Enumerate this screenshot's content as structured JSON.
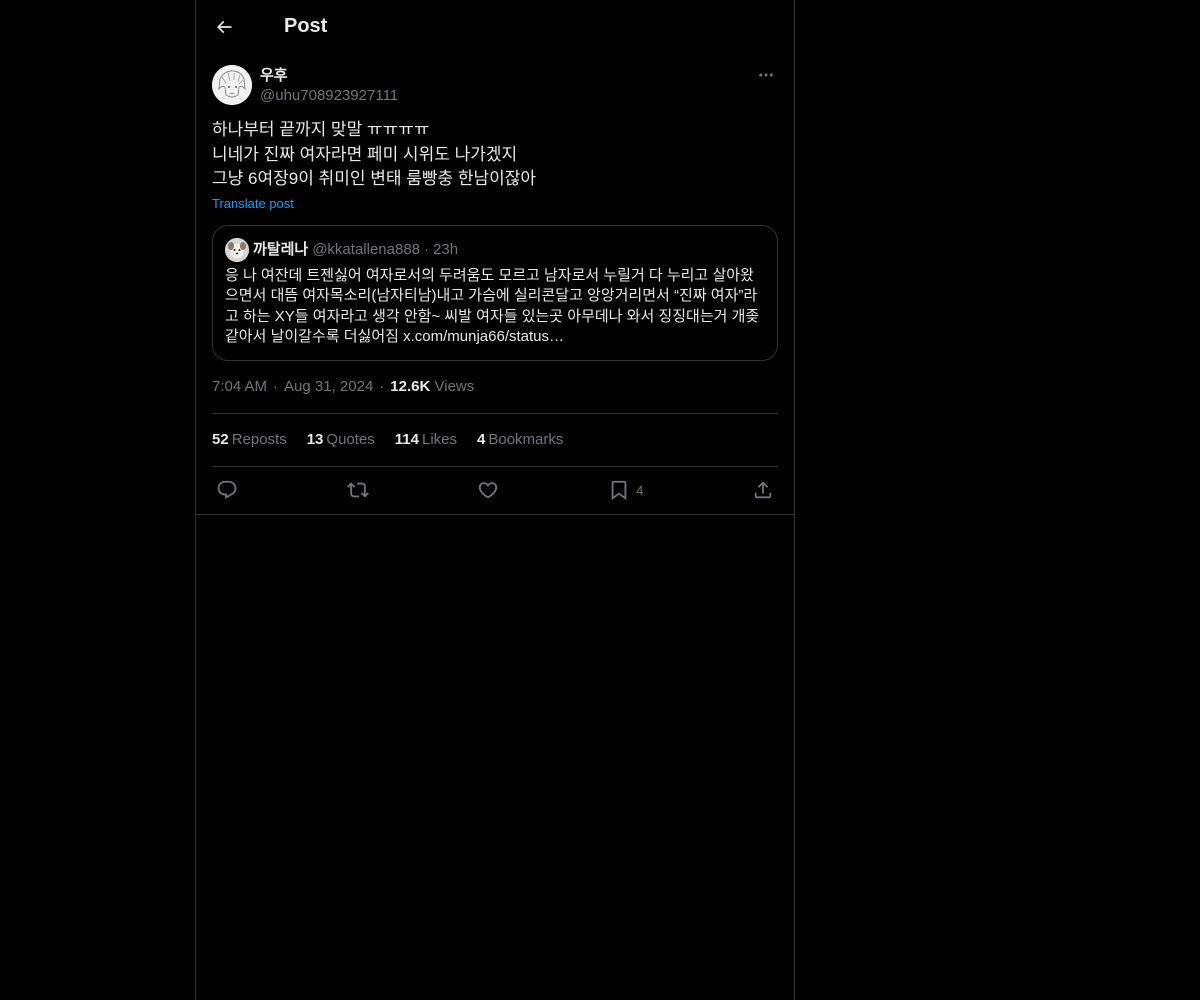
{
  "header": {
    "title": "Post",
    "back_icon": "arrow-left-icon"
  },
  "post": {
    "author": {
      "display_name": "우후",
      "handle": "@uhu708923927111"
    },
    "more_icon": "more-horizontal-icon",
    "body_lines": [
      "하나부터 끝까지 맞말 ㅠㅠㅠㅠ",
      "니네가 진짜 여자라면 페미 시위도 나가겠지",
      "그냥 6여장9이 취미인 변태 룸빵충 한남이잖아"
    ],
    "translate_label": "Translate post",
    "quote": {
      "display_name": "까탈레나",
      "handle": "@kkatallena888",
      "separator": "·",
      "time": "23h",
      "text": "응 나 여잔데 트젠싫어 여자로서의 두려움도 모르고 남자로서 누릴거 다 누리고 살아왔으면서 대뜸 여자목소리(남자티남)내고 가슴에 실리콘달고 앙앙거리면서 “진짜 여자”라고 하는 XY들 여자라고 생각 안함~ 씨발 여자들 있는곳 아무데나 와서 징징대는거 개좆같아서 날이갈수록 더싫어짐 x.com/munja66/status…"
    },
    "time": "7:04 AM",
    "separator": "·",
    "date": "Aug 31, 2024",
    "views_count": "12.6K",
    "views_label": "Views",
    "stats": [
      {
        "count": "52",
        "label": "Reposts"
      },
      {
        "count": "13",
        "label": "Quotes"
      },
      {
        "count": "114",
        "label": "Likes"
      },
      {
        "count": "4",
        "label": "Bookmarks"
      }
    ],
    "actions": {
      "reply_icon": "reply-icon",
      "repost_icon": "repost-icon",
      "like_icon": "heart-icon",
      "bookmark_icon": "bookmark-icon",
      "bookmark_count": "4",
      "share_icon": "share-icon"
    }
  },
  "colors": {
    "background": "#000000",
    "text": "#e7e9ea",
    "muted": "#71767b",
    "border": "#2f3336",
    "link": "#1d9bf0"
  }
}
